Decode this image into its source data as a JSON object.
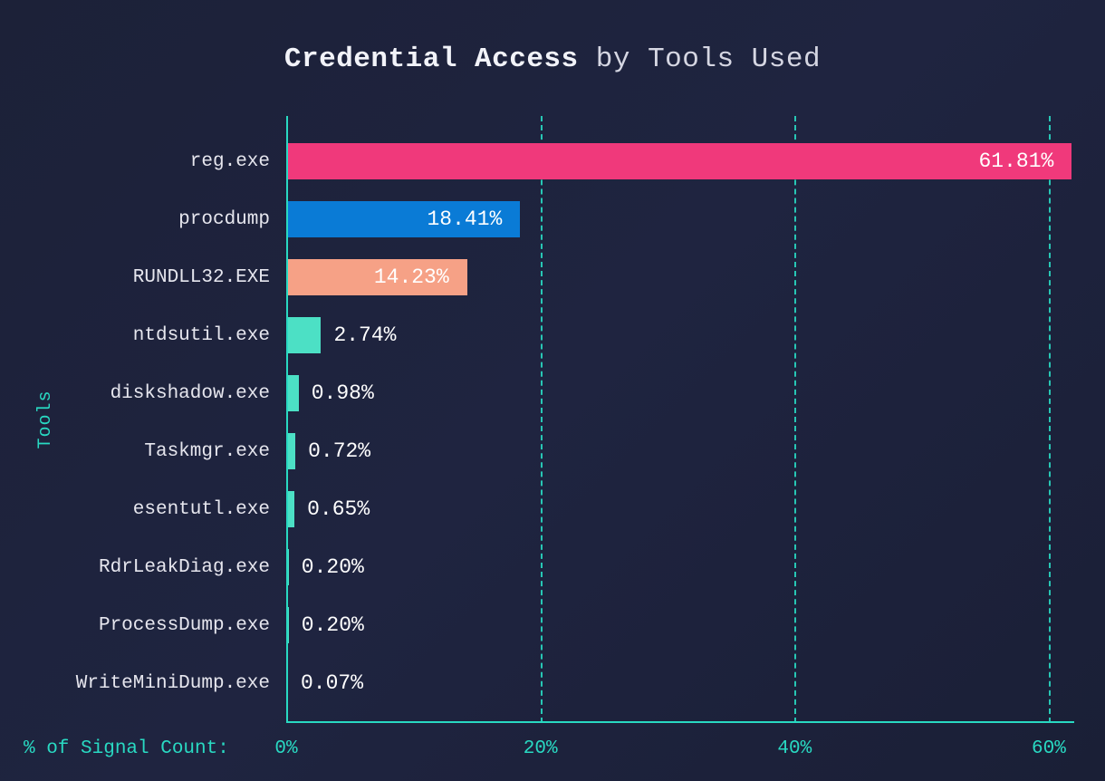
{
  "title_bold": "Credential Access",
  "title_rest": " by Tools Used",
  "ylabel": "Tools",
  "xlabel": "% of Signal Count:",
  "chart_data": {
    "type": "bar",
    "orientation": "horizontal",
    "title": "Credential Access by Tools Used",
    "xlabel": "% of Signal Count:",
    "ylabel": "Tools",
    "xlim": [
      0,
      62
    ],
    "xticks": [
      0,
      20,
      40,
      60
    ],
    "xtick_labels": [
      "0%",
      "20%",
      "40%",
      "60%"
    ],
    "categories": [
      "reg.exe",
      "procdump",
      "RUNDLL32.EXE",
      "ntdsutil.exe",
      "diskshadow.exe",
      "Taskmgr.exe",
      "esentutl.exe",
      "RdrLeakDiag.exe",
      "ProcessDump.exe",
      "WriteMiniDump.exe"
    ],
    "values": [
      61.81,
      18.41,
      14.23,
      2.74,
      0.98,
      0.72,
      0.65,
      0.2,
      0.2,
      0.07
    ],
    "value_labels": [
      "61.81%",
      "18.41%",
      "14.23%",
      "2.74%",
      "0.98%",
      "0.72%",
      "0.65%",
      "0.20%",
      "0.20%",
      "0.07%"
    ],
    "colors": [
      "#f0397b",
      "#0a7bd6",
      "#f6a186",
      "#4ce0c5",
      "#4ce0c5",
      "#4ce0c5",
      "#4ce0c5",
      "#4ce0c5",
      "#4ce0c5",
      "#4ce0c5"
    ],
    "grid": {
      "x": true,
      "y": false
    },
    "legend": false
  }
}
